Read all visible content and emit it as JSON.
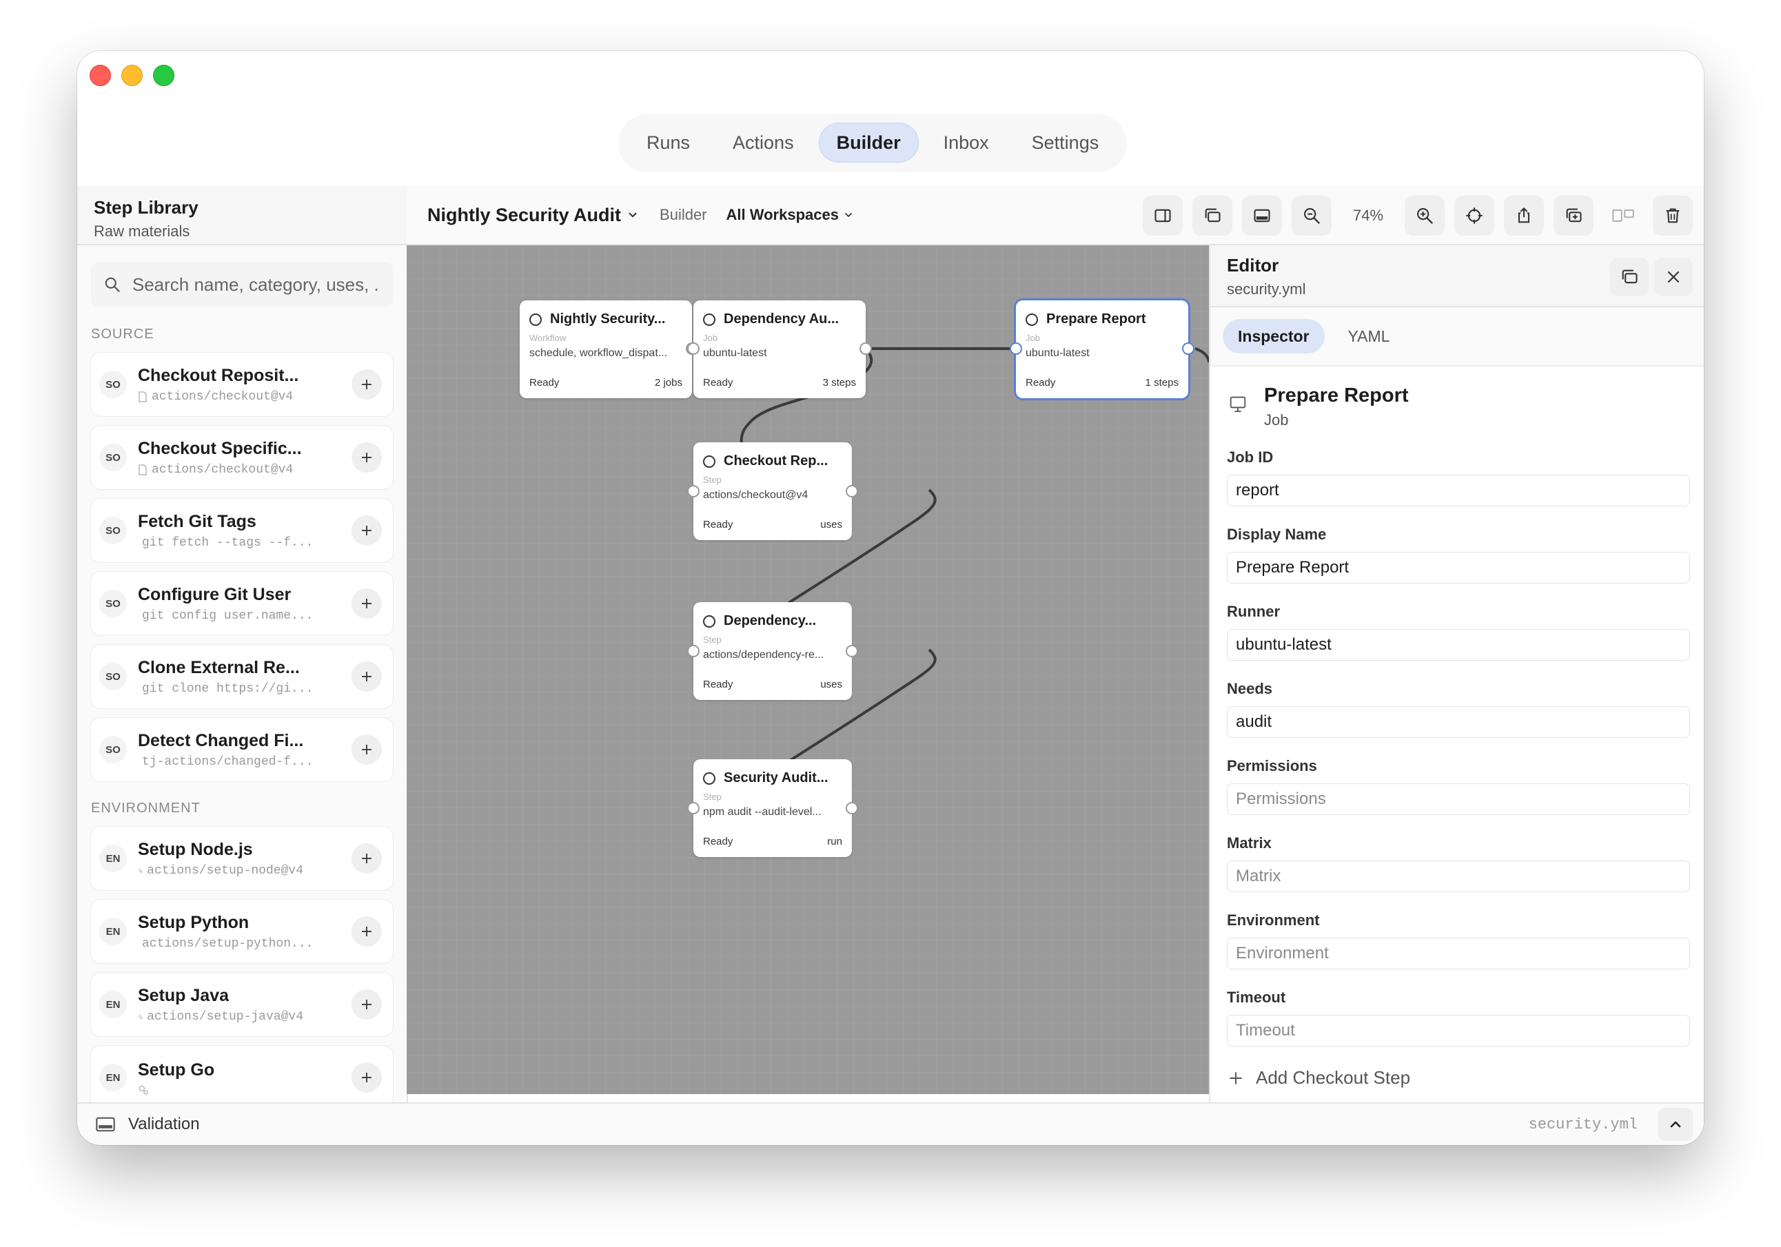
{
  "nav": {
    "tabs": [
      {
        "label": "Runs"
      },
      {
        "label": "Actions"
      },
      {
        "label": "Builder"
      },
      {
        "label": "Inbox"
      },
      {
        "label": "Settings"
      }
    ],
    "active": "Builder"
  },
  "sidebar": {
    "title": "Step Library",
    "subtitle": "Raw materials",
    "search_placeholder": "Search name, category, uses, ...",
    "sections": [
      {
        "label": "SOURCE",
        "items": [
          {
            "abbr": "SO",
            "name": "Checkout Reposit...",
            "uses": "actions/checkout@v4",
            "icon": "file-icon"
          },
          {
            "abbr": "SO",
            "name": "Checkout Specific...",
            "uses": "actions/checkout@v4",
            "icon": "file-icon"
          },
          {
            "abbr": "SO",
            "name": "Fetch Git Tags",
            "uses": "git fetch --tags --f...",
            "icon": "file-icon"
          },
          {
            "abbr": "SO",
            "name": "Configure Git User",
            "uses": "git config user.name...",
            "icon": "file-icon"
          },
          {
            "abbr": "SO",
            "name": "Clone External Re...",
            "uses": "git clone https://gi...",
            "icon": "file-icon"
          },
          {
            "abbr": "SO",
            "name": "Detect Changed Fi...",
            "uses": "tj-actions/changed-f...",
            "icon": "file-icon"
          }
        ]
      },
      {
        "label": "ENVIRONMENT",
        "items": [
          {
            "abbr": "EN",
            "name": "Setup Node.js",
            "uses": "actions/setup-node@v4",
            "icon": "gears-icon"
          },
          {
            "abbr": "EN",
            "name": "Setup Python",
            "uses": "actions/setup-python...",
            "icon": "gears-icon"
          },
          {
            "abbr": "EN",
            "name": "Setup Java",
            "uses": "actions/setup-java@v4",
            "icon": "gears-icon"
          },
          {
            "abbr": "EN",
            "name": "Setup Go",
            "uses": "",
            "icon": "gears-icon"
          }
        ]
      }
    ]
  },
  "toolbar": {
    "workflow_name": "Nightly Security Audit",
    "mode": "Builder",
    "workspace": "All Workspaces",
    "zoom": "74%"
  },
  "canvas": {
    "nodes": [
      {
        "title": "Nightly Security...",
        "kind": "Workflow",
        "detail": "schedule, workflow_dispat...",
        "status": "Ready",
        "meta": "2 jobs"
      },
      {
        "title": "Dependency Au...",
        "kind": "Job",
        "detail": "ubuntu-latest",
        "status": "Ready",
        "meta": "3 steps"
      },
      {
        "title": "Prepare Report",
        "kind": "Job",
        "detail": "ubuntu-latest",
        "status": "Ready",
        "meta": "1 steps"
      },
      {
        "title": "Checkout Rep...",
        "kind": "Step",
        "detail": "actions/checkout@v4",
        "status": "Ready",
        "meta": "uses"
      },
      {
        "title": "Dependency...",
        "kind": "Step",
        "detail": "actions/dependency-re...",
        "status": "Ready",
        "meta": "uses"
      },
      {
        "title": "Security Audit...",
        "kind": "Step",
        "detail": "npm audit --audit-level...",
        "status": "Ready",
        "meta": "run"
      }
    ]
  },
  "editor": {
    "title": "Editor",
    "file": "security.yml",
    "tabs": [
      {
        "label": "Inspector"
      },
      {
        "label": "YAML"
      }
    ],
    "active_tab": "Inspector",
    "selected": {
      "name": "Prepare Report",
      "type": "Job"
    },
    "fields": [
      {
        "label": "Job ID",
        "value": "report",
        "placeholder": "Job ID"
      },
      {
        "label": "Display Name",
        "value": "Prepare Report",
        "placeholder": "Display Name"
      },
      {
        "label": "Runner",
        "value": "ubuntu-latest",
        "placeholder": "Runner"
      },
      {
        "label": "Needs",
        "value": "audit",
        "placeholder": "Needs"
      },
      {
        "label": "Permissions",
        "value": "",
        "placeholder": "Permissions"
      },
      {
        "label": "Matrix",
        "value": "",
        "placeholder": "Matrix"
      },
      {
        "label": "Environment",
        "value": "",
        "placeholder": "Environment"
      },
      {
        "label": "Timeout",
        "value": "",
        "placeholder": "Timeout"
      }
    ],
    "add_step_label": "Add Checkout Step"
  },
  "statusbar": {
    "validation_label": "Validation",
    "file": "security.yml"
  },
  "colors": {
    "accent": "#5b7fd6",
    "active_tab_bg": "#dbe5f7",
    "canvas_bg": "#9a9a9a"
  }
}
